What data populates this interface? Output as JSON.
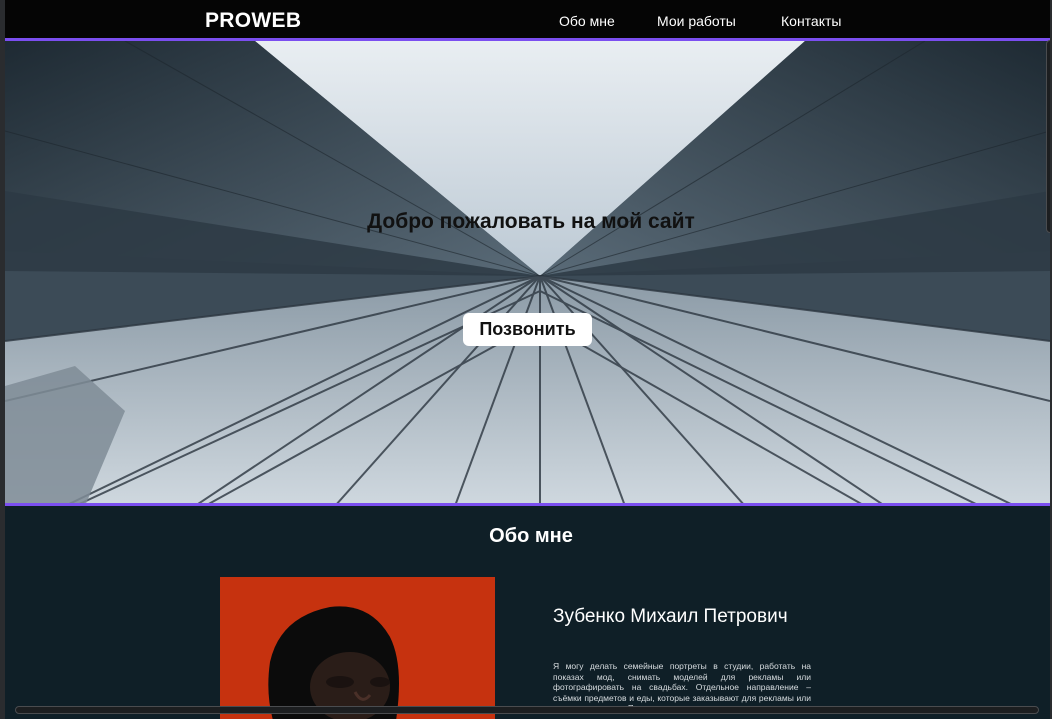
{
  "header": {
    "logo": "PROWEB",
    "nav": [
      {
        "label": "Обо мне"
      },
      {
        "label": "Мои работы"
      },
      {
        "label": "Контакты"
      }
    ]
  },
  "hero": {
    "title": "Добро пожаловать на мой сайт",
    "button_label": "Позвонить"
  },
  "about": {
    "title": "Обо мне",
    "name": "Зубенко Михаил Петрович",
    "bio": "Я могу делать семейные портреты в студии, работать на показах мод, снимать моделей для рекламы или фотографировать на свадьбах. Отдельное направление – съёмки предметов и еды, которые заказывают для рекламы или меню ресторанов. Я"
  },
  "colors": {
    "accent": "#7b4ef0",
    "header_bg": "#050505",
    "section_bg": "#0f1f27",
    "photo_bg": "#c6320f"
  }
}
